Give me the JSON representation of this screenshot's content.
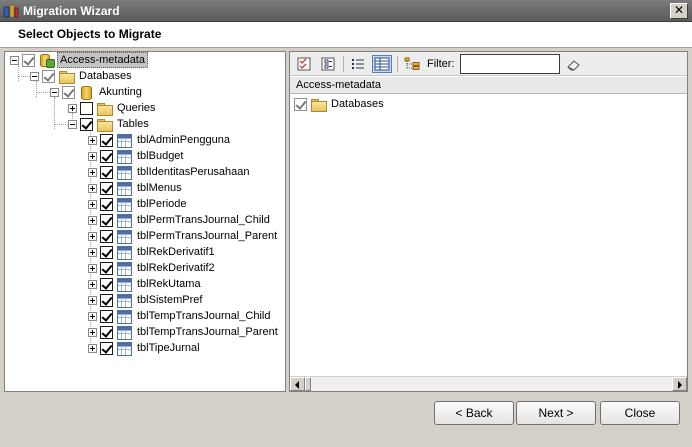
{
  "window": {
    "title": "Migration Wizard",
    "close_glyph": "✕"
  },
  "header": {
    "heading": "Select Objects to Migrate"
  },
  "tree": {
    "root": "Access-metadata",
    "databases": "Databases",
    "db": "Akunting",
    "queries": "Queries",
    "tables": "Tables",
    "table_items": [
      "tblAdminPengguna",
      "tblBudget",
      "tblIdentitasPerusahaan",
      "tblMenus",
      "tblPeriode",
      "tblPermTransJournal_Child",
      "tblPermTransJournal_Parent",
      "tblRekDerivatif1",
      "tblRekDerivatif2",
      "tblRekUtama",
      "tblSistemPref",
      "tblTempTransJournal_Child",
      "tblTempTransJournal_Parent",
      "tblTipeJurnal"
    ]
  },
  "toolbar": {
    "filter_label": "Filter:",
    "filter_value": ""
  },
  "list": {
    "header": "Access-metadata",
    "items": [
      "Databases"
    ]
  },
  "buttons": {
    "back": "< Back",
    "next": "Next >",
    "close": "Close"
  },
  "icons": {
    "app": "migration-wizard-icon",
    "tree_root": "access-metadata-icon",
    "folder": "folder-icon",
    "database": "database-icon",
    "table": "table-icon",
    "toolbar": [
      "check-all-icon",
      "uncheck-all-icon",
      "list-view-icon",
      "details-view-icon",
      "tree-filter-icon",
      "eraser-icon"
    ]
  }
}
